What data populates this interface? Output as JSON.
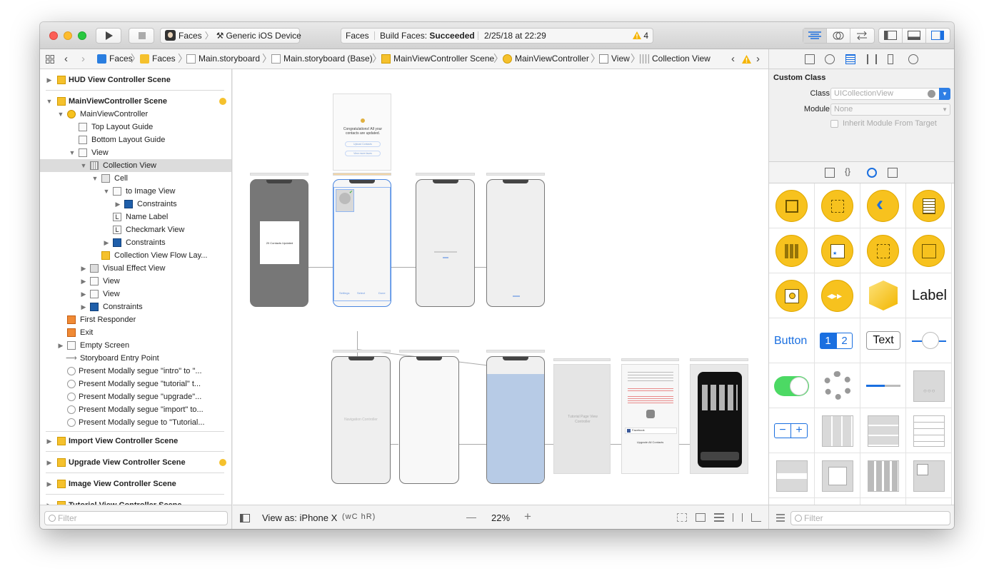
{
  "window": {
    "scheme": {
      "project": "Faces",
      "device": "Generic iOS Device"
    },
    "activity": {
      "project": "Faces",
      "build_prefix": "Build Faces:",
      "build_status": "Succeeded",
      "datetime": "2/25/18 at 22:29",
      "warning_count": "4"
    }
  },
  "jumpbar": {
    "crumbs": [
      "Faces",
      "Faces",
      "Main.storyboard",
      "Main.storyboard (Base)",
      "MainViewController Scene",
      "MainViewController",
      "View",
      "Collection View"
    ]
  },
  "navigator": {
    "items": [
      {
        "label": "HUD View Controller Scene"
      },
      {
        "label": "MainViewController Scene"
      },
      {
        "label": "MainViewController"
      },
      {
        "label": "Top Layout Guide"
      },
      {
        "label": "Bottom Layout Guide"
      },
      {
        "label": "View"
      },
      {
        "label": "Collection View"
      },
      {
        "label": "Cell"
      },
      {
        "label": "to Image View"
      },
      {
        "label": "Constraints"
      },
      {
        "label": "Name Label"
      },
      {
        "label": "Checkmark View"
      },
      {
        "label": "Constraints"
      },
      {
        "label": "Collection View Flow Lay..."
      },
      {
        "label": "Visual Effect View"
      },
      {
        "label": "View"
      },
      {
        "label": "View"
      },
      {
        "label": "Constraints"
      },
      {
        "label": "First Responder"
      },
      {
        "label": "Exit"
      },
      {
        "label": "Empty Screen"
      },
      {
        "label": "Storyboard Entry Point"
      },
      {
        "label": "Present Modally segue \"intro\" to \"..."
      },
      {
        "label": "Present Modally segue \"tutorial\" t..."
      },
      {
        "label": "Present Modally segue \"upgrade\"..."
      },
      {
        "label": "Present Modally segue \"import\" to..."
      },
      {
        "label": "Present Modally segue to \"Tutorial..."
      },
      {
        "label": "Import View Controller Scene"
      },
      {
        "label": "Upgrade View Controller Scene"
      },
      {
        "label": "Image View Controller Scene"
      },
      {
        "label": "Tutorial View Controller Scene"
      }
    ],
    "filter_placeholder": "Filter"
  },
  "canvas": {
    "view_as_label": "View as: iPhone X",
    "size_class": "(wC hR)",
    "zoom": "22%",
    "zoom_out": "—",
    "zoom_in": "+",
    "scenes": {
      "success_title": "Congratulations! All your contacts are updated.",
      "upload_contacts": "Upload Contacts",
      "view_more": "View more faces",
      "contacts_updated": "20 Contacts Updated",
      "navigation_controller": "Navigation Controller",
      "tutorial_page": "Tutorial Page View Controller",
      "facebook": "Facebook",
      "upgrade_contacts": "Upgrade All Contacts",
      "left_tab": "Settings",
      "mid_tab": "Select",
      "right_tab": "Done"
    }
  },
  "inspector": {
    "section_title": "Custom Class",
    "class_label": "Class",
    "class_placeholder": "UICollectionView",
    "module_label": "Module",
    "module_value": "None",
    "inherit_label": "Inherit Module From Target",
    "inherit_checked": false
  },
  "library": {
    "label_text": "Label",
    "button_text": "Button",
    "seg_one": "1",
    "seg_two": "2",
    "text_field": "Text",
    "filter_placeholder": "Filter"
  },
  "colors": {
    "accent": "#1a6fe0",
    "warning": "#f5b400",
    "scene_yellow": "#f7c21e"
  }
}
